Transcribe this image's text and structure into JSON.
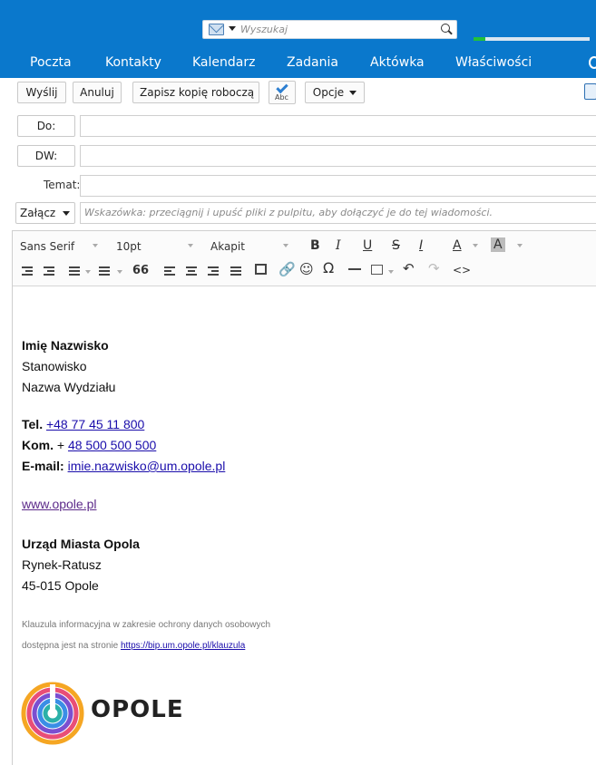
{
  "header": {
    "search": {
      "placeholder": "Wyszukaj",
      "has_account_dropdown": true
    },
    "progress": {
      "fraction": 0.1
    },
    "nav_tabs": [
      {
        "label": "Poczta"
      },
      {
        "label": "Kontakty"
      },
      {
        "label": "Kalendarz"
      },
      {
        "label": "Zadania"
      },
      {
        "label": "Aktówka"
      },
      {
        "label": "Właściwości"
      }
    ],
    "colors": {
      "bar": "#0a78cc",
      "progress": "#22c13a"
    }
  },
  "toolbar": {
    "send_label": "Wyślij",
    "cancel_label": "Anuluj",
    "save_draft_label": "Zapisz kopię roboczą",
    "spellcheck_icon": "spellcheck-abc-icon",
    "spellcheck_text": "Abc",
    "options_label": "Opcje"
  },
  "compose": {
    "to_label": "Do:",
    "to_value": "",
    "cc_label": "DW:",
    "cc_value": "",
    "subject_label": "Temat:",
    "subject_value": "",
    "attach_label": "Załącz",
    "attach_hint": "Wskazówka: przeciągnij i upuść pliki z pulpitu, aby dołączyć je do tej wiadomości."
  },
  "format_bar": {
    "font_family": "Sans Serif",
    "font_size": "10pt",
    "paragraph": "Akapit",
    "buttons_row1": [
      "bold",
      "italic",
      "underline",
      "strikethrough",
      "clear-format",
      "font-color",
      "background-color"
    ],
    "buttons_row2": [
      "outdent",
      "indent",
      "bullet-list",
      "numbered-list",
      "blockquote",
      "align-left",
      "align-center",
      "align-right",
      "justify",
      "image",
      "link",
      "emoticon",
      "special-char",
      "horizontal-rule",
      "table",
      "undo",
      "redo",
      "source-code"
    ],
    "glyphs": {
      "bold": "B",
      "italic": "I",
      "underline": "U",
      "strike": "S",
      "clear": "I",
      "color": "A",
      "quote": "66",
      "omega": "Ω",
      "source": "<>"
    }
  },
  "signature": {
    "name": "Imię Nazwisko",
    "position": "Stanowisko",
    "department": "Nazwa Wydziału",
    "tel_label": "Tel.",
    "tel_value": "+48 77 45 11 800",
    "mobile_label": "Kom.",
    "mobile_prefix": "+",
    "mobile_value": "48 500 500 500",
    "email_label": "E-mail:",
    "email_value": "imie.nazwisko@um.opole.pl",
    "website": "www.opole.pl",
    "org_name": "Urząd Miasta Opola",
    "street": "Rynek-Ratusz",
    "city": "45-015 Opole",
    "clause_line1": "Klauzula informacyjna w zakresie ochrony danych osobowych",
    "clause_line2_prefix": "dostępna jest na stronie",
    "clause_link": "https://bip.um.opole.pl/klauzula",
    "logo_text": "OPOLE"
  }
}
